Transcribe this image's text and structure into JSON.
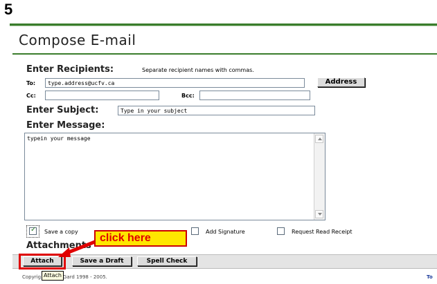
{
  "step_number": "5",
  "page_title": "Compose E-mail",
  "recipients": {
    "heading": "Enter Recipients:",
    "hint": "Separate recipient names with commas.",
    "to_label": "To:",
    "to_value": "type.address@ucfv.ca",
    "address_button": "Address",
    "cc_label": "Cc:",
    "cc_value": "",
    "bcc_label": "Bcc:",
    "bcc_value": ""
  },
  "subject": {
    "heading": "Enter Subject:",
    "value": "Type in your subject"
  },
  "message": {
    "heading": "Enter Message:",
    "value": "typein your message"
  },
  "options": {
    "save_copy_label": "Save a copy",
    "save_copy_checked": true,
    "add_signature_label": "Add Signature",
    "add_signature_checked": false,
    "read_receipt_label": "Request Read Receipt",
    "read_receipt_checked": false
  },
  "attachments_heading": "Attachments",
  "toolbar": {
    "attach_label": "Attach",
    "save_draft_label": "Save a Draft",
    "spell_check_label": "Spell Check"
  },
  "footer": {
    "copyright_prefix": "Copyrig",
    "copyright_suffix": "unGard 1998 - 2005.",
    "right_link": "To"
  },
  "tooltip_text": "Attach",
  "annotation": {
    "callout_text": "click here",
    "callout_color": "#ffe600",
    "arrow_color": "#e00000"
  },
  "colors": {
    "accent_green": "#3a7d2c",
    "highlight_red": "#e00000"
  }
}
